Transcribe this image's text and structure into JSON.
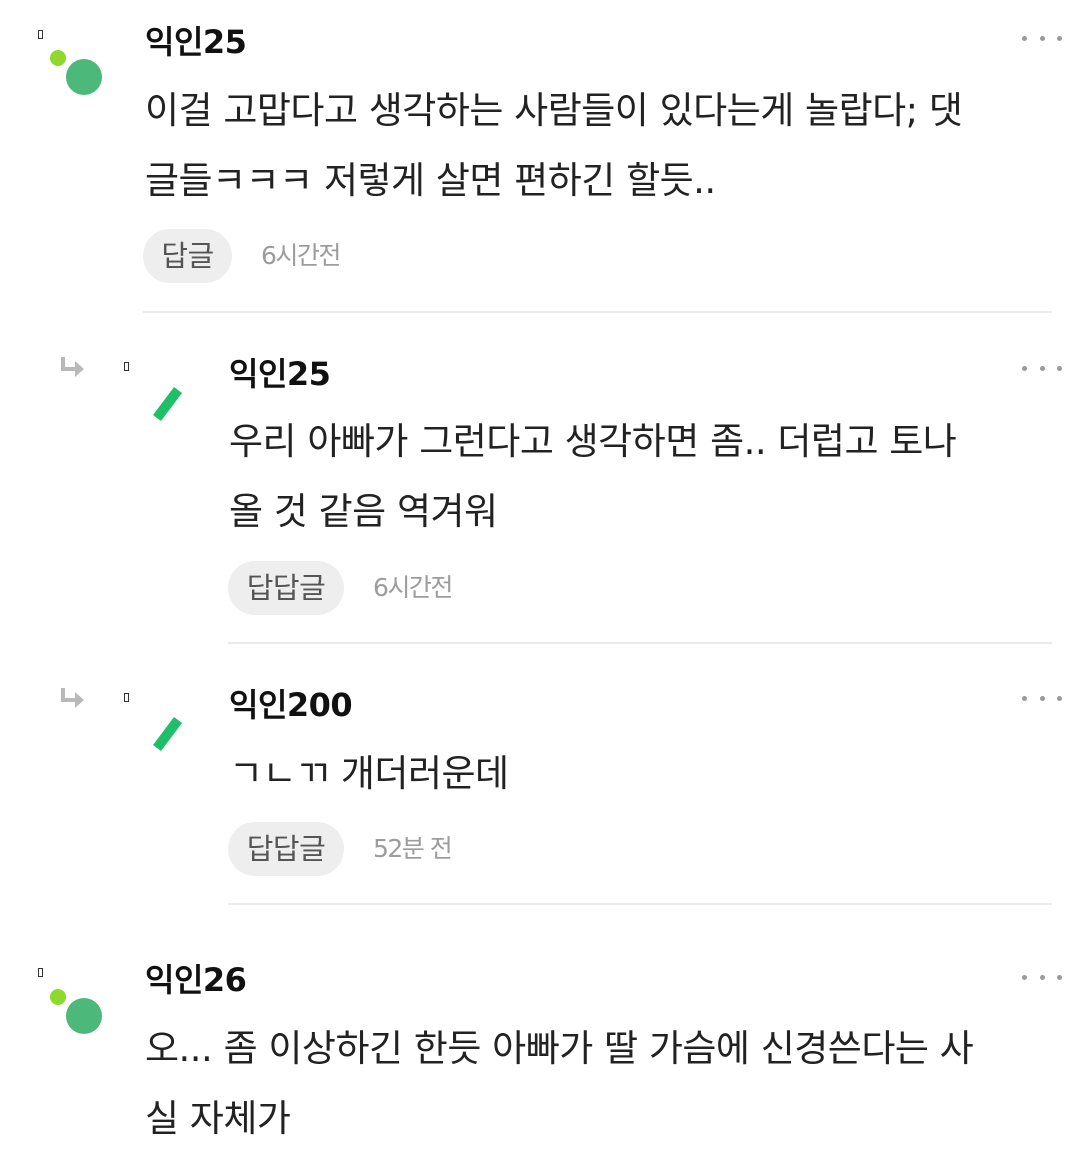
{
  "comments": [
    {
      "nickname": "익인25",
      "lines": [
        "이걸 고맙다고 생각하는 사람들이 있다는게 놀랍다; 댓",
        "글들ㅋㅋㅋ 저렇게 살면 편하긴 할듯.."
      ],
      "reply_label": "답글",
      "time": "6시간전",
      "avatar_icon": "green-dot-avatar-icon"
    },
    {
      "nickname": "익인25",
      "lines": [
        "우리 아빠가 그런다고 생각하면 좀.. 더럽고 토나",
        "올 것 같음 역겨워"
      ],
      "reply_label": "답답글",
      "time": "6시간전",
      "avatar_icon": "green-slash-avatar-icon",
      "reply_icon": "reply-arrow-icon"
    },
    {
      "nickname": "익인200",
      "lines": [
        "ㄱㄴㄲ 개더러운데"
      ],
      "reply_label": "답답글",
      "time": "52분 전",
      "avatar_icon": "green-slash-avatar-icon",
      "reply_icon": "reply-arrow-icon"
    },
    {
      "nickname": "익인26",
      "lines": [
        "오... 좀 이상하긴 한듯 아빠가 딸 가슴에 신경쓴다는 사",
        "실 자체가"
      ],
      "avatar_icon": "green-dot-avatar-icon"
    }
  ],
  "colors": {
    "avatar_green": "#4cb97a",
    "avatar_lime": "#8ed92e",
    "slash_green": "#1fbf6a",
    "reply_bg": "#eeeeee",
    "divider": "#ebebeb"
  }
}
